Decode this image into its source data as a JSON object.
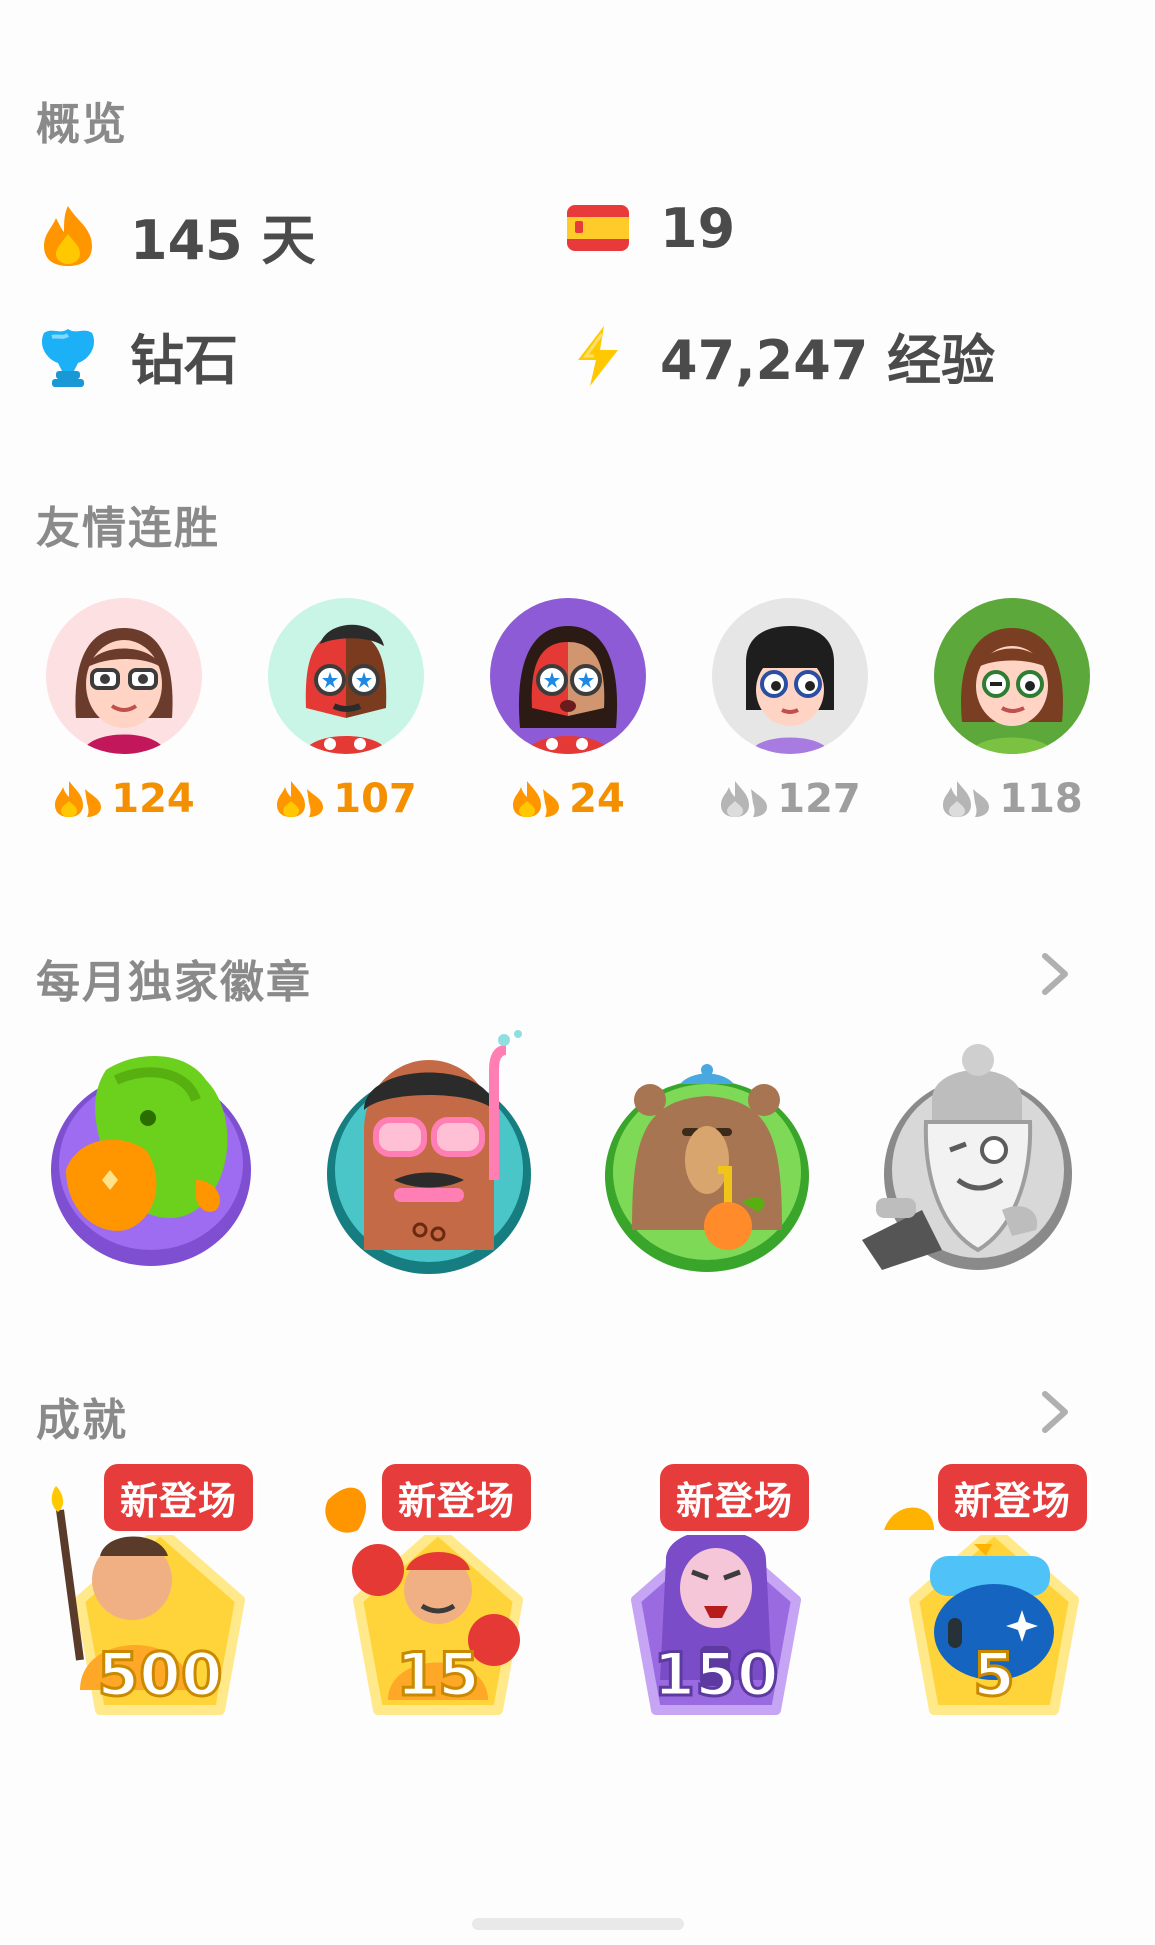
{
  "overview": {
    "title": "概览",
    "streak": "145 天",
    "language_count": "19",
    "league": "钻石",
    "xp": "47,247 经验"
  },
  "friend_streaks": {
    "title": "友情连胜",
    "friends": [
      {
        "count": "124",
        "active": true
      },
      {
        "count": "107",
        "active": true
      },
      {
        "count": "24",
        "active": true
      },
      {
        "count": "127",
        "active": false
      },
      {
        "count": "118",
        "active": false
      }
    ]
  },
  "monthly_badges": {
    "title": "每月独家徽章"
  },
  "achievements": {
    "title": "成就",
    "items": [
      {
        "tag": "新登场",
        "level": "500"
      },
      {
        "tag": "新登场",
        "level": "15"
      },
      {
        "tag": "新登场",
        "level": "150"
      },
      {
        "tag": "新登场",
        "level": "5"
      }
    ]
  },
  "colors": {
    "accent_orange": "#f49000",
    "tag_red": "#e73c3c",
    "title_gray": "#8a8a8a"
  },
  "icons": [
    "fire-icon",
    "spain-flag-icon",
    "diamond-trophy-icon",
    "lightning-icon",
    "chevron-right-icon"
  ]
}
